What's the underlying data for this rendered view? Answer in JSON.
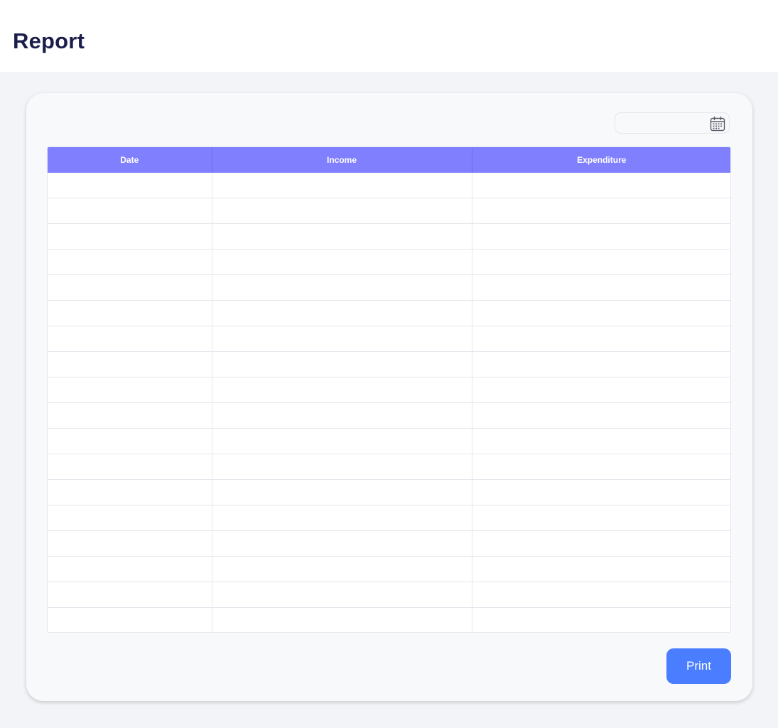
{
  "header": {
    "title": "Report"
  },
  "filter": {
    "date_value": "",
    "icon": "calendar-icon"
  },
  "table": {
    "columns": [
      "Date",
      "Income",
      "Expenditure"
    ],
    "rows": [
      [
        "",
        "",
        ""
      ],
      [
        "",
        "",
        ""
      ],
      [
        "",
        "",
        ""
      ],
      [
        "",
        "",
        ""
      ],
      [
        "",
        "",
        ""
      ],
      [
        "",
        "",
        ""
      ],
      [
        "",
        "",
        ""
      ],
      [
        "",
        "",
        ""
      ],
      [
        "",
        "",
        ""
      ],
      [
        "",
        "",
        ""
      ],
      [
        "",
        "",
        ""
      ],
      [
        "",
        "",
        ""
      ],
      [
        "",
        "",
        ""
      ],
      [
        "",
        "",
        ""
      ],
      [
        "",
        "",
        ""
      ],
      [
        "",
        "",
        ""
      ],
      [
        "",
        "",
        ""
      ],
      [
        "",
        "",
        ""
      ]
    ]
  },
  "actions": {
    "print_label": "Print"
  },
  "colors": {
    "header_row": "#8080ff",
    "print_button": "#4a7dff",
    "title": "#1b1e4b"
  }
}
